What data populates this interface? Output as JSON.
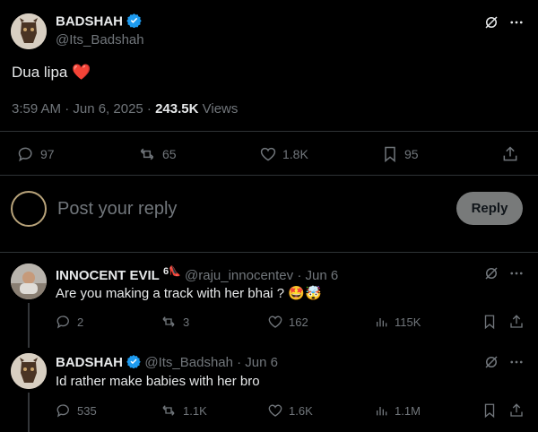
{
  "tweet": {
    "author_name": "BADSHAH",
    "author_handle": "@Its_Badshah",
    "text": "Dua lipa",
    "text_emoji": "❤️",
    "time": "3:59 AM · Jun 6, 2025 · ",
    "views_count": "243.5K",
    "views_label": " Views",
    "stats": {
      "replies": "97",
      "reposts": "65",
      "likes": "1.8K",
      "bookmarks": "95"
    }
  },
  "composer": {
    "placeholder": "Post your reply",
    "button_label": "Reply"
  },
  "replies": [
    {
      "author_name": "INNOCENT EVIL",
      "badge": "6",
      "badge_emoji": "👠",
      "handle_time": "@raju_innocentev · Jun 6",
      "text": "Are you making a track with her bhai ? ",
      "emojis": "🤩🤯",
      "stats": {
        "replies": "2",
        "reposts": "3",
        "likes": "162",
        "views": "115K"
      }
    },
    {
      "author_name": "BADSHAH",
      "handle_time": "@Its_Badshah · Jun 6",
      "text": "Id rather make babies with her bro",
      "stats": {
        "replies": "535",
        "reposts": "1.1K",
        "likes": "1.6K",
        "views": "1.1M"
      }
    }
  ],
  "colors": {
    "background": "#000000",
    "text": "#e7e9ea",
    "muted": "#71767b",
    "verified": "#1d9bf0",
    "heart": "#f91880",
    "divider": "#2f3336"
  }
}
